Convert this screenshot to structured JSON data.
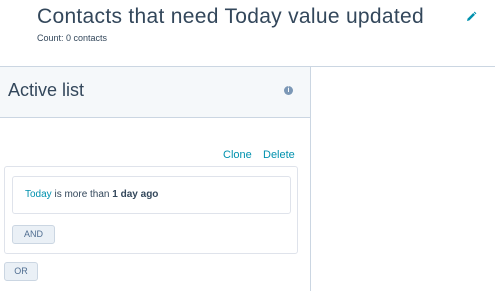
{
  "header": {
    "title": "Contacts that need Today value updated",
    "count": "Count: 0 contacts",
    "edit_icon": "pencil-icon"
  },
  "panel": {
    "title": "Active list",
    "info_icon": "info-icon",
    "info_glyph": "i",
    "clone_label": "Clone",
    "delete_label": "Delete",
    "filter": {
      "property": "Today",
      "operator": " is more than ",
      "value": "1 day ago"
    },
    "and_label": "AND",
    "or_label": "OR"
  },
  "colors": {
    "accent": "#0091ae",
    "text": "#33475b",
    "panel_header_bg": "#f5f8fa",
    "border": "#cbd6e2"
  }
}
